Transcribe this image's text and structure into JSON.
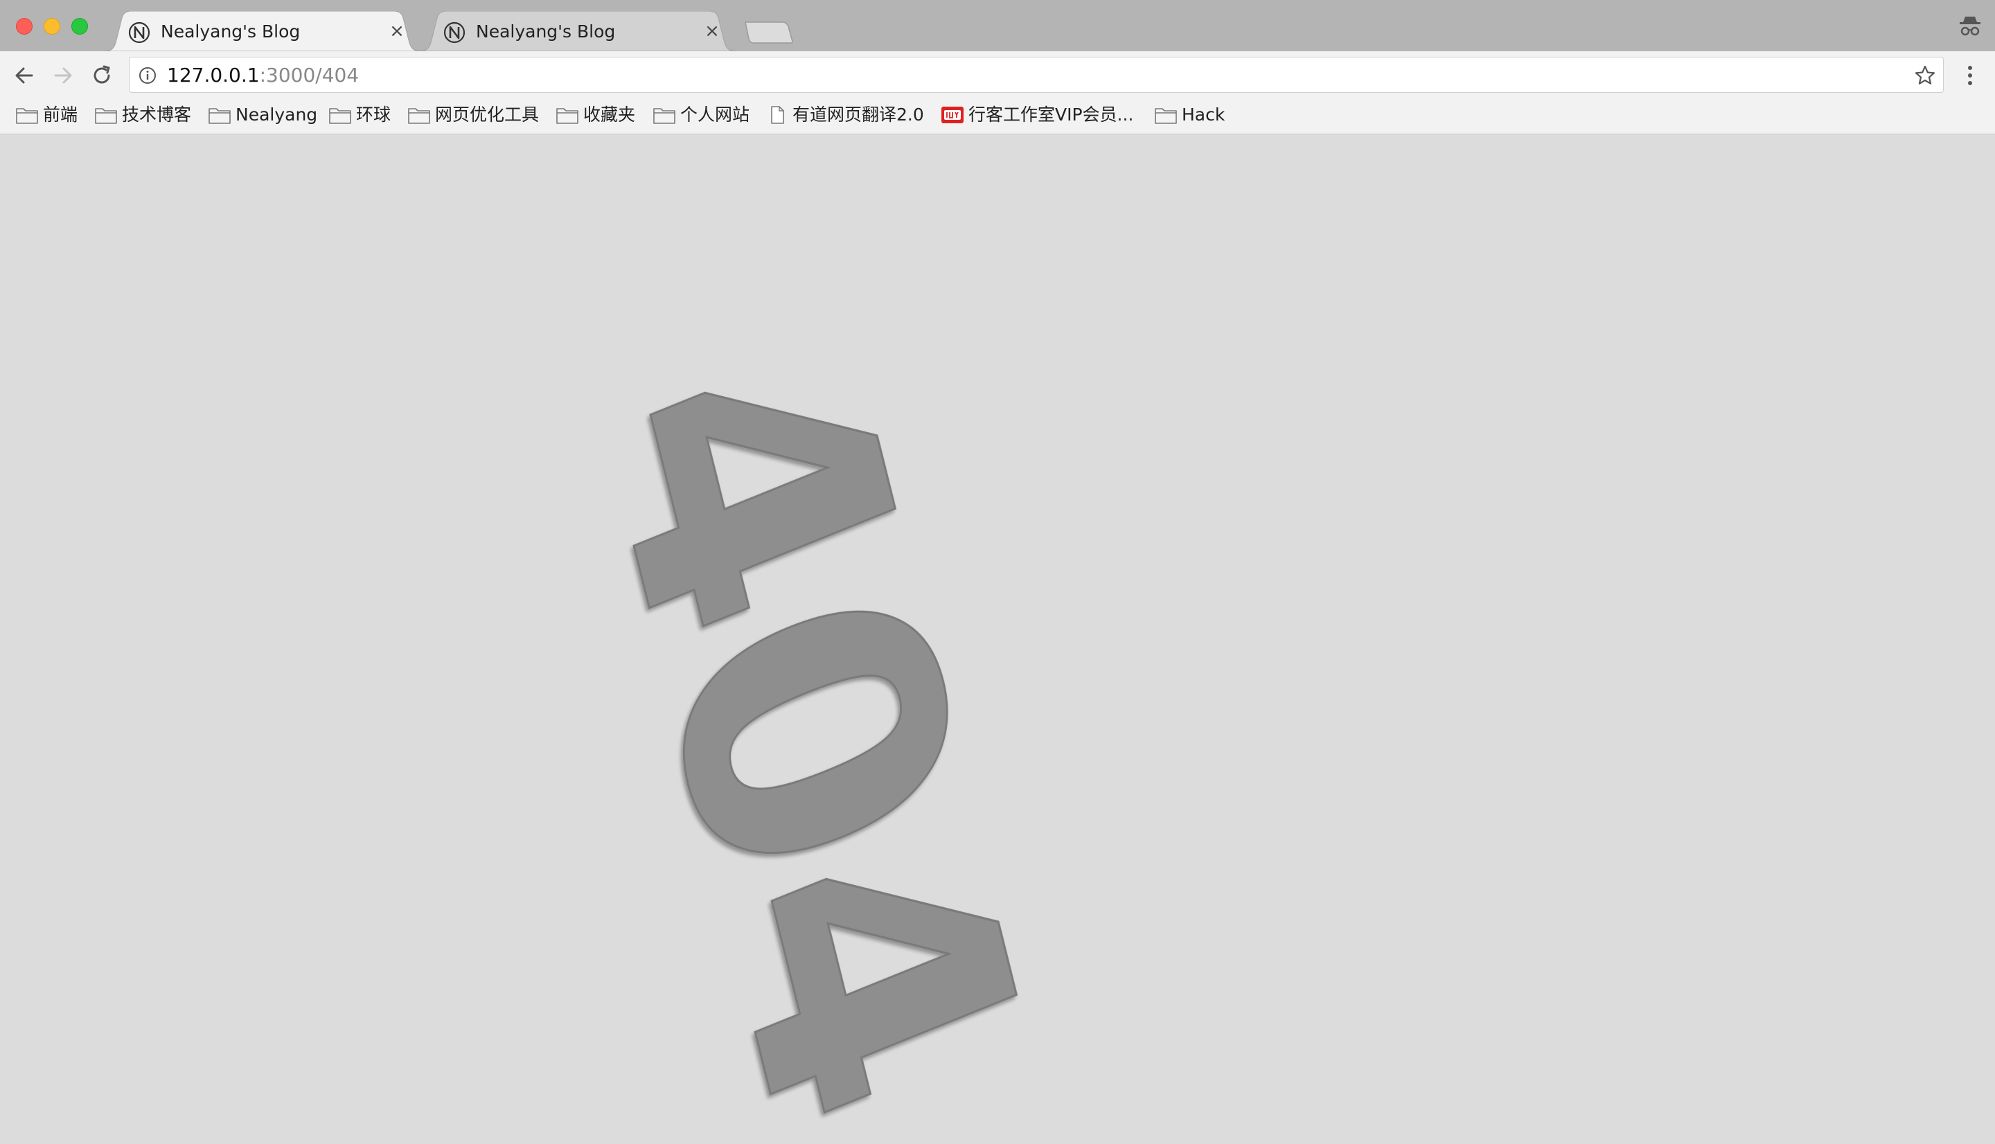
{
  "tabs": [
    {
      "title": "Nealyang's Blog",
      "close": "×"
    },
    {
      "title": "Nealyang's Blog",
      "close": "×"
    }
  ],
  "address_bar": {
    "host": "127.0.0.1",
    "path": ":3000/404"
  },
  "bookmarks": [
    {
      "label": "前端",
      "icon": "folder-icon"
    },
    {
      "label": "技术博客",
      "icon": "folder-icon"
    },
    {
      "label": "Nealyang",
      "icon": "folder-icon"
    },
    {
      "label": "环球",
      "icon": "folder-icon"
    },
    {
      "label": "网页优化工具",
      "icon": "folder-icon"
    },
    {
      "label": "收藏夹",
      "icon": "folder-icon"
    },
    {
      "label": "个人网站",
      "icon": "folder-icon"
    },
    {
      "label": "有道网页翻译2.0",
      "icon": "page-icon"
    },
    {
      "label": "行客工作室VIP会员...",
      "icon": "iqiyi-icon"
    },
    {
      "label": "Hack",
      "icon": "folder-icon"
    }
  ],
  "content": {
    "error_code": "404"
  },
  "colors": {
    "page_background": "#dcdcdc",
    "error_text": "#8e8e8e",
    "chrome_toolbar": "#f2f2f2",
    "tab_strip": "#b4b4b4"
  }
}
